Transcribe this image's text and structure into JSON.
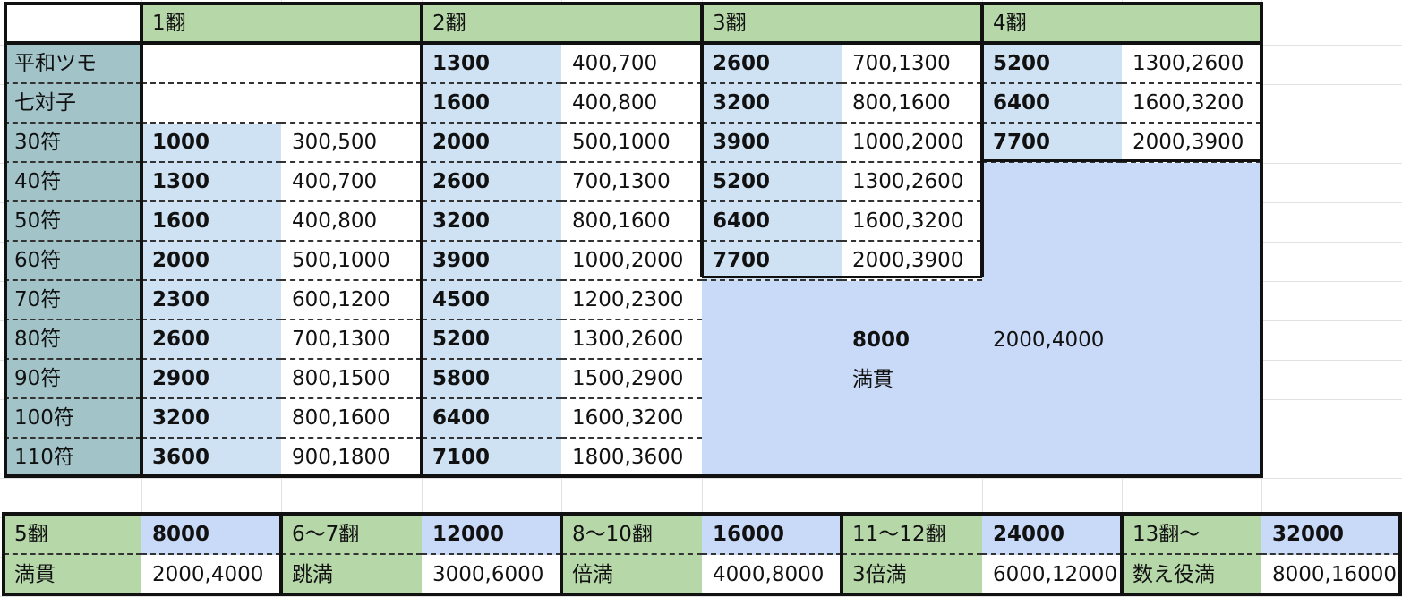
{
  "header": {
    "cols": [
      "1翻",
      "2翻",
      "3翻",
      "4翻"
    ]
  },
  "rows": [
    {
      "label": "平和ツモ",
      "h1": [
        "",
        ""
      ],
      "h2": [
        "1300",
        "400,700"
      ],
      "h3": [
        "2600",
        "700,1300"
      ],
      "h4": [
        "5200",
        "1300,2600"
      ]
    },
    {
      "label": "七対子",
      "h1": [
        "",
        ""
      ],
      "h2": [
        "1600",
        "400,800"
      ],
      "h3": [
        "3200",
        "800,1600"
      ],
      "h4": [
        "6400",
        "1600,3200"
      ]
    },
    {
      "label": "30符",
      "h1": [
        "1000",
        "300,500"
      ],
      "h2": [
        "2000",
        "500,1000"
      ],
      "h3": [
        "3900",
        "1000,2000"
      ],
      "h4": [
        "7700",
        "2000,3900"
      ]
    },
    {
      "label": "40符",
      "h1": [
        "1300",
        "400,700"
      ],
      "h2": [
        "2600",
        "700,1300"
      ],
      "h3": [
        "5200",
        "1300,2600"
      ]
    },
    {
      "label": "50符",
      "h1": [
        "1600",
        "400,800"
      ],
      "h2": [
        "3200",
        "800,1600"
      ],
      "h3": [
        "6400",
        "1600,3200"
      ]
    },
    {
      "label": "60符",
      "h1": [
        "2000",
        "500,1000"
      ],
      "h2": [
        "3900",
        "1000,2000"
      ],
      "h3": [
        "7700",
        "2000,3900"
      ]
    },
    {
      "label": "70符",
      "h1": [
        "2300",
        "600,1200"
      ],
      "h2": [
        "4500",
        "1200,2300"
      ]
    },
    {
      "label": "80符",
      "h1": [
        "2600",
        "700,1300"
      ],
      "h2": [
        "5200",
        "1300,2600"
      ]
    },
    {
      "label": "90符",
      "h1": [
        "2900",
        "800,1500"
      ],
      "h2": [
        "5800",
        "1500,2900"
      ]
    },
    {
      "label": "100符",
      "h1": [
        "3200",
        "800,1600"
      ],
      "h2": [
        "6400",
        "1600,3200"
      ]
    },
    {
      "label": "110符",
      "h1": [
        "3600",
        "900,1800"
      ],
      "h2": [
        "7100",
        "1800,3600"
      ]
    }
  ],
  "mangan_block": {
    "points": "8000",
    "split": "2000,4000",
    "name": "満貫"
  },
  "limits": [
    {
      "han": "5翻",
      "name": "満貫",
      "points": "8000",
      "split": "2000,4000"
    },
    {
      "han": "6〜7翻",
      "name": "跳満",
      "points": "12000",
      "split": "3000,6000"
    },
    {
      "han": "8〜10翻",
      "name": "倍満",
      "points": "16000",
      "split": "4000,8000"
    },
    {
      "han": "11〜12翻",
      "name": "3倍満",
      "points": "24000",
      "split": "6000,12000"
    },
    {
      "han": "13翻〜",
      "name": "数え役満",
      "points": "32000",
      "split": "8000,16000"
    }
  ],
  "colors": {
    "header_green": "#b6d7a8",
    "label_teal": "#a2c4c9",
    "points_blue": "#cfe2f3",
    "mangan_periwinkle": "#c9daf8"
  }
}
